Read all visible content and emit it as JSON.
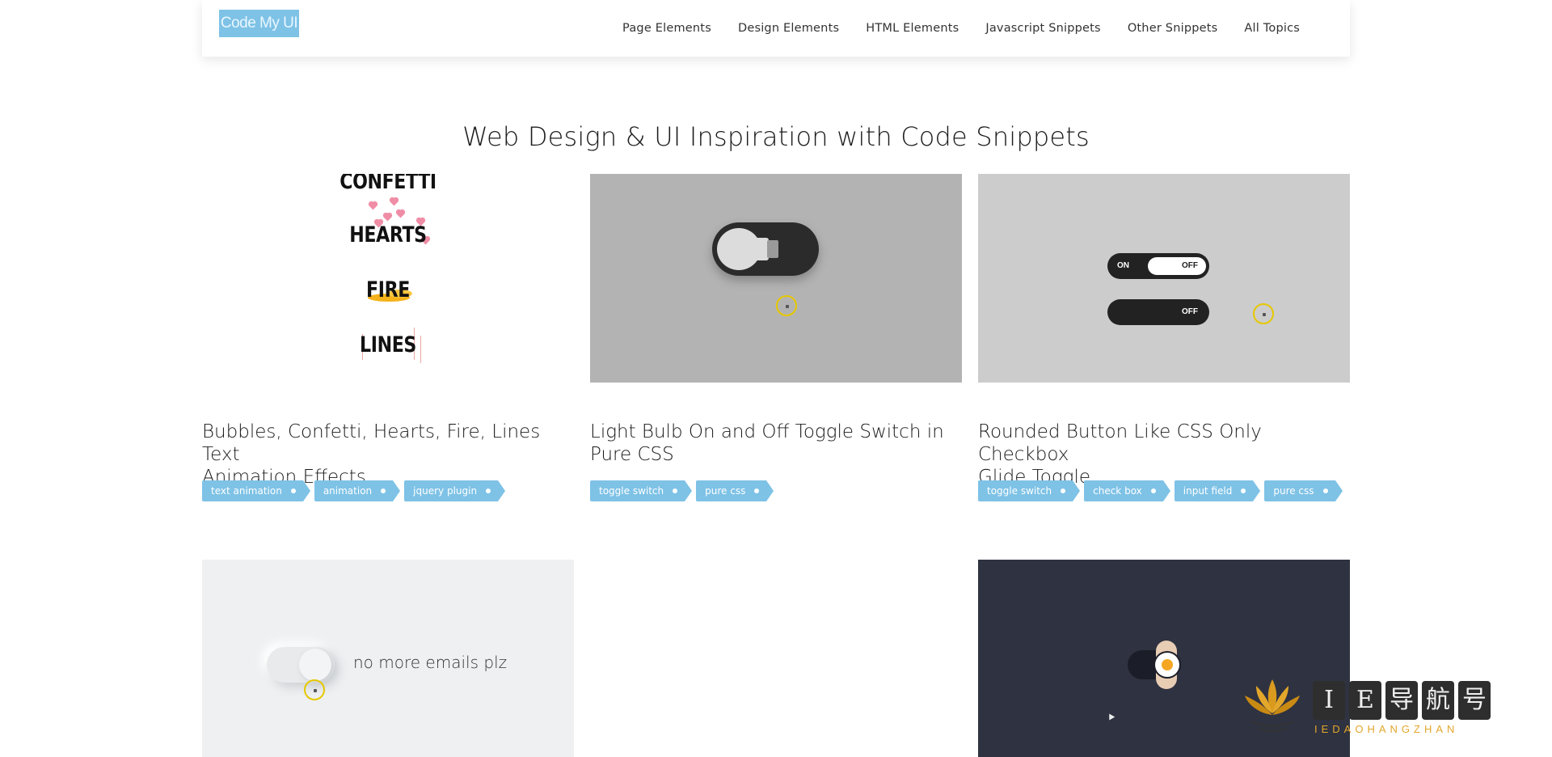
{
  "header": {
    "logo_text": "Code My UI",
    "nav": [
      {
        "label": "Page Elements"
      },
      {
        "label": "Design Elements"
      },
      {
        "label": "HTML Elements"
      },
      {
        "label": "Javascript Snippets"
      },
      {
        "label": "Other Snippets"
      },
      {
        "label": "All Topics"
      }
    ]
  },
  "page_title": "Web Design & UI Inspiration with Code Snippets",
  "cards": [
    {
      "preview_words": [
        "CONFETTI",
        "HEARTS",
        "FIRE",
        "LINES"
      ],
      "title_line1": "Bubbles, Confetti, Hearts, Fire, Lines Text",
      "title_line2": "Animation Effects",
      "tags": [
        "text animation",
        "animation",
        "jquery plugin"
      ]
    },
    {
      "title_line1": "Light Bulb On and Off Toggle Switch in",
      "title_line2": "Pure CSS",
      "tags": [
        "toggle switch",
        "pure css"
      ]
    },
    {
      "preview": {
        "on_label": "ON",
        "off_label_1": "OFF",
        "off_label_2": "OFF"
      },
      "title_line1": "Rounded Button Like CSS Only Checkbox",
      "title_line2": "Glide Toggle",
      "tags": [
        "toggle switch",
        "check box",
        "input field",
        "pure css"
      ]
    },
    {
      "preview_text": "no more emails plz"
    },
    {},
    {}
  ],
  "watermark": {
    "chars": [
      "I",
      "E",
      "导",
      "航",
      "号"
    ],
    "sub": "IEDAOHANGZHAN"
  },
  "colors": {
    "accent": "#7ec2e6",
    "watermark_gold": "#e3a72b"
  }
}
